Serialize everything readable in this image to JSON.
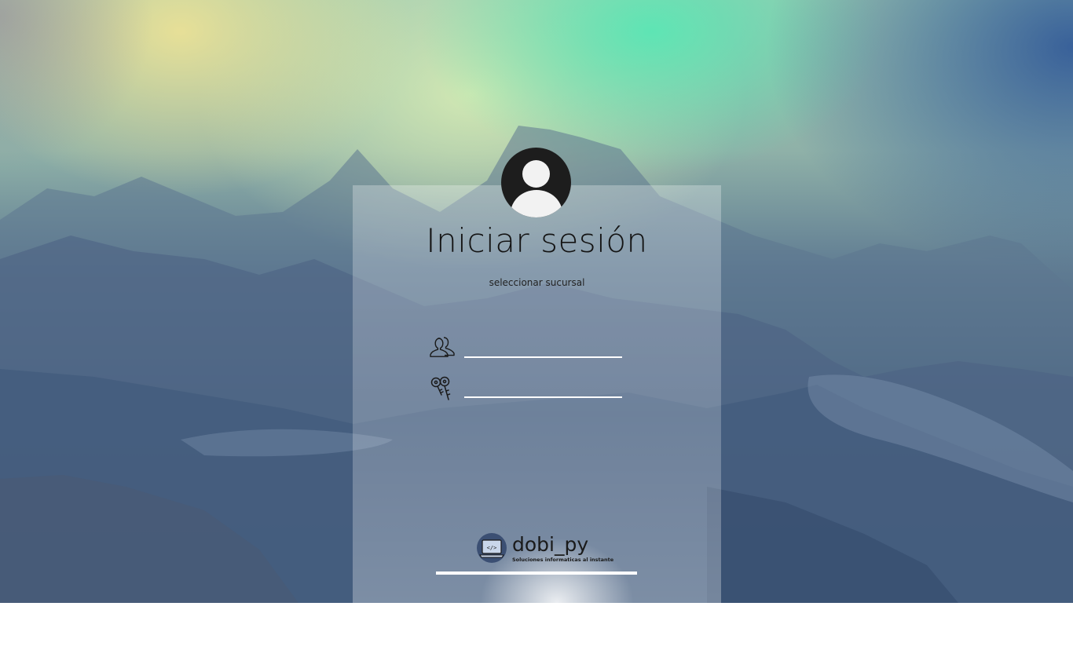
{
  "login": {
    "title": "Iniciar sesión",
    "branch_selector": "seleccionar sucursal",
    "username": {
      "value": "",
      "placeholder": ""
    },
    "password": {
      "value": "",
      "placeholder": ""
    }
  },
  "brand": {
    "name": "dobi_py",
    "tagline": "Soluciones informaticas al instante"
  },
  "icons": {
    "avatar": "user-avatar-icon",
    "user": "users-icon",
    "password": "keys-icon",
    "logo": "laptop-code-icon"
  },
  "colors": {
    "text": "#141414",
    "avatar_bg": "#1d1d1d",
    "underline": "#ffffff"
  }
}
